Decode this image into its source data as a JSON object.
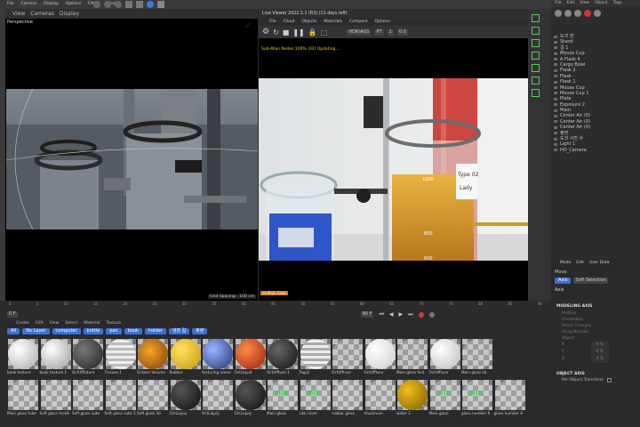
{
  "top_menu": [
    "File",
    "Camera",
    "Display",
    "Options",
    "Filter",
    "Panel"
  ],
  "viewport_left": {
    "label": "Perspective",
    "grid_spacing": "Grid Spacing : 100 cm"
  },
  "live_viewer": {
    "title": "Live Viewer 2022.1.1 (R3) (11 days left)",
    "menu": [
      "File",
      "Cloud",
      "Objects",
      "Materials",
      "Compare",
      "Options"
    ],
    "status": "Sub-Main Nodes:100% (02) Updating...",
    "mode": "HDR/AGS",
    "pt": "PT",
    "val1": "1",
    "val2": "0.0",
    "bottom_tag": "ca Main Color",
    "labels": [
      "1000",
      "800",
      "600",
      "Type 02",
      "Lady",
      "Dyn"
    ]
  },
  "objects": [
    "도크 전",
    "Stand",
    "걸 1",
    "Mouse Cup",
    "A Flask 4",
    "Cargo Bowl",
    "Flask 2",
    "Flask",
    "Flask 1",
    "Mouse Cup",
    "Mouse Cup 1",
    "Plate",
    "Exposure 2",
    "Main",
    "Center Air (0)",
    "Center Air (0)",
    "Center Air (0)",
    "평면",
    "도크 사진 수",
    "Light 1",
    "HO_Camera"
  ],
  "attributes": {
    "tabs": [
      "Mode",
      "Edit",
      "User Data"
    ],
    "move": "Move",
    "sub_tabs": [
      "Axis",
      "Soft Selection"
    ],
    "section1": "Axis",
    "section2": "MODELING AXIS",
    "rows": [
      "Position",
      "Orientation",
      "Retain Changes",
      "Along Normals",
      "Object"
    ],
    "xyz": [
      [
        "X",
        "0 %"
      ],
      [
        "Y",
        "0 %"
      ],
      [
        "Z",
        "0 %"
      ]
    ],
    "section3": "OBJECT AXIS",
    "per_object": "Per-Object Transform"
  },
  "timeline": {
    "frame": "0 F",
    "end": "90 F",
    "ticks": [
      "0",
      "5",
      "10",
      "15",
      "20",
      "25",
      "30",
      "35",
      "40",
      "45",
      "50",
      "55",
      "60",
      "65",
      "70",
      "75",
      "80",
      "85",
      "90"
    ]
  },
  "materials": {
    "menu": [
      "Create",
      "Edit",
      "View",
      "Select",
      "Material",
      "Texture"
    ],
    "tags": [
      "All",
      "No Layer",
      "computer",
      "bottle",
      "pan",
      "book",
      "holder",
      "냉장 컵",
      "화분"
    ],
    "row1": [
      "book texture",
      "book texture 1",
      "OctUffluture",
      "Tissuex 1",
      "Octane Volume",
      "Rubber",
      "texturing scene",
      "OctLiquid",
      "OctUffluse 1",
      "Tags2",
      "OctUffluse",
      "OctUffluse",
      "Main glass fest",
      "OctUffluse",
      "Main glass lid"
    ],
    "row2": [
      "Main glass tube",
      "Soft glass mode",
      "Soft glass subs",
      "Soft glass subs 1",
      "Soft glass lid",
      "OctLiquiy",
      "OctLiquiy",
      "OctLiquiy",
      "Main glass",
      "Lab cover",
      "rubber glass",
      "Aluminum",
      "water 2",
      "Main glass",
      "glass number 6",
      "glass number 8"
    ]
  },
  "colors": {
    "accent": "#3d6fd8",
    "mix_green": "#3bd14f",
    "play_red": "#d23a3a"
  }
}
